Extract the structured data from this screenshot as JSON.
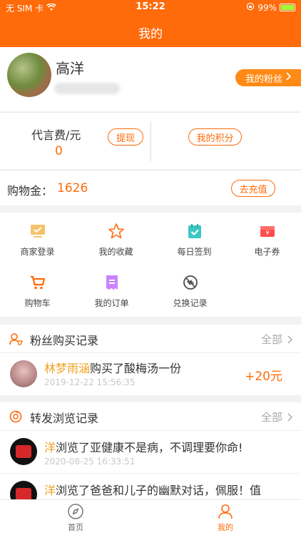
{
  "status": {
    "carrier": "无 SIM 卡",
    "time": "15:22",
    "battery": "99%"
  },
  "nav": {
    "title": "我的"
  },
  "profile": {
    "name": "高洋",
    "fans_button": "我的粉丝"
  },
  "finance": {
    "fee_label": "代言费/元",
    "fee_value": "0",
    "withdraw": "提现",
    "points": "我的积分"
  },
  "shopping_gold": {
    "label": "购物金：",
    "value": "1626",
    "recharge": "去充值"
  },
  "menu": [
    {
      "label": "商家登录",
      "icon": "merchant-login-icon"
    },
    {
      "label": "我的收藏",
      "icon": "favorite-star-icon"
    },
    {
      "label": "每日签到",
      "icon": "daily-checkin-icon"
    },
    {
      "label": "电子券",
      "icon": "coupon-icon"
    },
    {
      "label": "购物车",
      "icon": "cart-icon"
    },
    {
      "label": "我的订单",
      "icon": "order-icon"
    },
    {
      "label": "兑换记录",
      "icon": "exchange-record-icon"
    }
  ],
  "fans_purchase": {
    "title": "粉丝购买记录",
    "more": "全部",
    "items": [
      {
        "name": "林梦雨涵",
        "action": "购买了酸梅汤一份",
        "time": "2019-12-22 15:56:35",
        "amount": "+20元"
      }
    ]
  },
  "forward_browse": {
    "title": "转发浏览记录",
    "more": "全部",
    "items": [
      {
        "name": "洋",
        "action": "浏览了亚健康不是病，不调理要你命!",
        "time": "2020-08-25 16:33:51"
      },
      {
        "name": "洋",
        "action": "浏览了爸爸和儿子的幽默对话，佩服！值",
        "time": ""
      }
    ]
  },
  "tabbar": {
    "home": "首页",
    "mine": "我的"
  },
  "colors": {
    "brand": "#ff6a0a",
    "highlight_name": "#f0a21f"
  }
}
